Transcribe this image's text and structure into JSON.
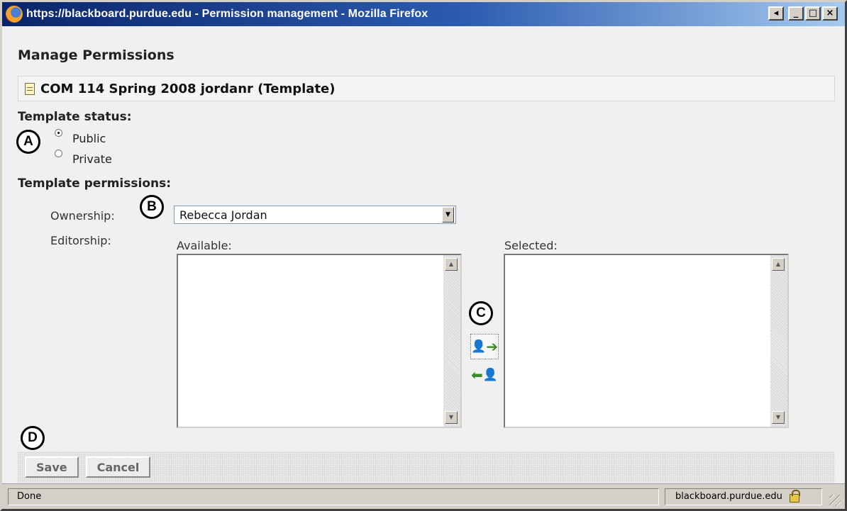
{
  "window": {
    "title": "https://blackboard.purdue.edu - Permission management - Mozilla Firefox",
    "controls": {
      "extra": "◂",
      "minimize": "_",
      "maximize": "□",
      "close": "×"
    }
  },
  "page": {
    "title": "Manage Permissions",
    "course_title": "COM 114 Spring 2008 jordanr (Template)"
  },
  "template_status": {
    "label": "Template status:",
    "options": [
      {
        "label": "Public",
        "selected": true
      },
      {
        "label": "Private",
        "selected": false
      }
    ]
  },
  "permissions": {
    "label": "Template permissions:",
    "ownership_label": "Ownership:",
    "ownership_value": "Rebecca Jordan",
    "editorship_label": "Editorship:",
    "available_label": "Available:",
    "selected_label": "Selected:",
    "add_icon": "add-person-icon",
    "remove_icon": "remove-person-icon"
  },
  "callouts": {
    "a": "A",
    "b": "B",
    "c": "C",
    "d": "D"
  },
  "buttons": {
    "save": "Save",
    "cancel": "Cancel"
  },
  "status_bar": {
    "status": "Done",
    "host": "blackboard.purdue.edu"
  }
}
